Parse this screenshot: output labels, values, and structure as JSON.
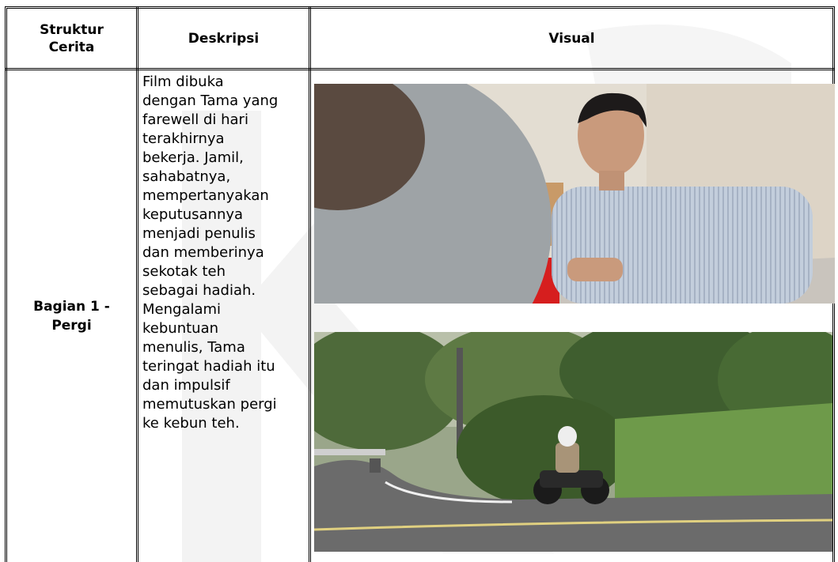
{
  "table": {
    "headers": {
      "structure": "Struktur Cerita",
      "description": "Deskripsi",
      "visual": "Visual"
    },
    "rows": [
      {
        "structure": "Bagian 1 - Pergi",
        "description": "Film dibuka\ndengan Tama yang\nfarewell di hari\nterakhirnya\nbekerja. Jamil,\nsahabatnya,\nmempertanyakan\nkeputusannya\nmenjadi penulis\ndan memberinya\nsekotak teh\nsebagai hadiah.\nMengalami\nkebuntuan\nmenulis, Tama\nteringat hadiah itu\ndan impulsif\nmemutuskan pergi\nke kebun teh.",
        "visuals": [
          "office-scene-photo",
          "motorcycle-tea-plantation-photo"
        ]
      }
    ]
  }
}
